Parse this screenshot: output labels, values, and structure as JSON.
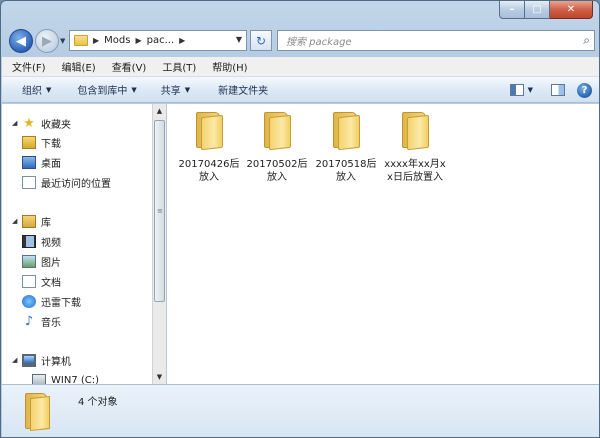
{
  "window": {
    "caption": {
      "minimize": "–",
      "maximize": "□",
      "close": "✕"
    }
  },
  "address": {
    "back_glyph": "◀",
    "forward_glyph": "▶",
    "crumbs": [
      "Mods",
      "pac..."
    ],
    "search_placeholder": "搜索 package"
  },
  "menu": [
    "文件(F)",
    "编辑(E)",
    "查看(V)",
    "工具(T)",
    "帮助(H)"
  ],
  "commands": [
    "组织",
    "包含到库中",
    "共享",
    "新建文件夹"
  ],
  "nav": {
    "favorites": "收藏夹",
    "favorite_items": [
      "下载",
      "桌面",
      "最近访问的位置"
    ],
    "library": "库",
    "library_items": [
      "视频",
      "图片",
      "文档",
      "迅雷下载",
      "音乐"
    ],
    "computer": "计算机",
    "computer_items": [
      "WIN7 (C:)"
    ]
  },
  "folders": [
    "20170426后放入",
    "20170502后放入",
    "20170518后放入",
    "xxxx年xx月xx日后放置入"
  ],
  "status": {
    "count_text": "4 个对象"
  },
  "colors": {
    "accent": "#2e6cc0",
    "folder": "#f3d36f",
    "chrome": "#b5cbe2"
  }
}
